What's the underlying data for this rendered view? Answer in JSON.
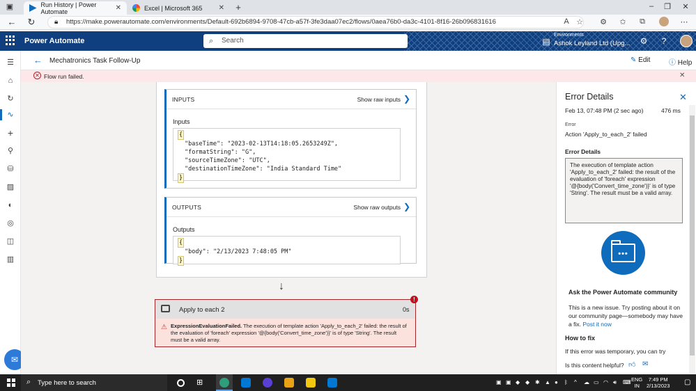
{
  "browser": {
    "tabs": [
      {
        "title": "Run History | Power Automate",
        "active": true
      },
      {
        "title": "Excel | Microsoft 365",
        "active": false
      }
    ],
    "url": "https://make.powerautomate.com/environments/Default-692b6894-9708-47cb-a57f-3fe3daa07ec2/flows/0aea76b0-da3c-4101-8f16-26b096831616"
  },
  "header": {
    "brand": "Power Automate",
    "search_placeholder": "Search",
    "env_label": "Environments",
    "env_name": "Ashok Leyland Ltd (Upg..."
  },
  "command_bar": {
    "flow_title": "Mechatronics Task Follow-Up",
    "edit_label": "Edit",
    "help_label": "Help"
  },
  "banner": {
    "text": "Flow run failed."
  },
  "run": {
    "inputs_header": "INPUTS",
    "show_raw_inputs": "Show raw inputs",
    "inputs_sub": "Inputs",
    "inputs_code": {
      "open": "{",
      "lines": [
        "\"baseTime\": \"2023-02-13T14:18:05.2653249Z\",",
        "\"formatString\": \"G\",",
        "\"sourceTimeZone\": \"UTC\",",
        "\"destinationTimeZone\": \"India Standard Time\""
      ],
      "close": "}"
    },
    "outputs_header": "OUTPUTS",
    "show_raw_outputs": "Show raw outputs",
    "outputs_sub": "Outputs",
    "outputs_code": {
      "open": "{",
      "lines": [
        "\"body\": \"2/13/2023 7:48:05 PM\""
      ],
      "close": "}"
    },
    "apply_each": {
      "title": "Apply to each 2",
      "duration": "0s",
      "badge": "!",
      "error_name": "ExpressionEvaluationFailed.",
      "error_text": " The execution of template action 'Apply_to_each_2' failed: the result of the evaluation of 'foreach' expression '@{body('Convert_time_zone')}' is of type 'String'. The result must be a valid array."
    }
  },
  "panel": {
    "title": "Error Details",
    "time": "Feb 13, 07:48 PM (2 sec ago)",
    "duration": "476 ms",
    "error_label": "Error",
    "error_text": "Action 'Apply_to_each_2' failed",
    "details_label": "Error Details",
    "details_text": "The execution of template action 'Apply_to_each_2' failed: the result of the evaluation of 'foreach' expression '@{body('Convert_time_zone')}' is of type 'String'. The result must be a valid array.",
    "community_title": "Ask the Power Automate community",
    "community_text": "This is a new issue. Try posting about it on our community page—somebody may have a fix.",
    "community_link": "Post it now",
    "fix_title": "How to fix",
    "fix_text": "If this error was temporary, you can try",
    "helpful_text": "Is this content helpful?"
  },
  "taskbar": {
    "search_placeholder": "Type here to search",
    "lang_line1": "ENG",
    "lang_line2": "IN",
    "time": "7:49 PM",
    "date": "2/13/2023"
  },
  "colors": {
    "brand_header": "#0f3f7f",
    "accent": "#0f6cbd",
    "error": "#a4262c",
    "error_bg": "#fde7e9"
  }
}
